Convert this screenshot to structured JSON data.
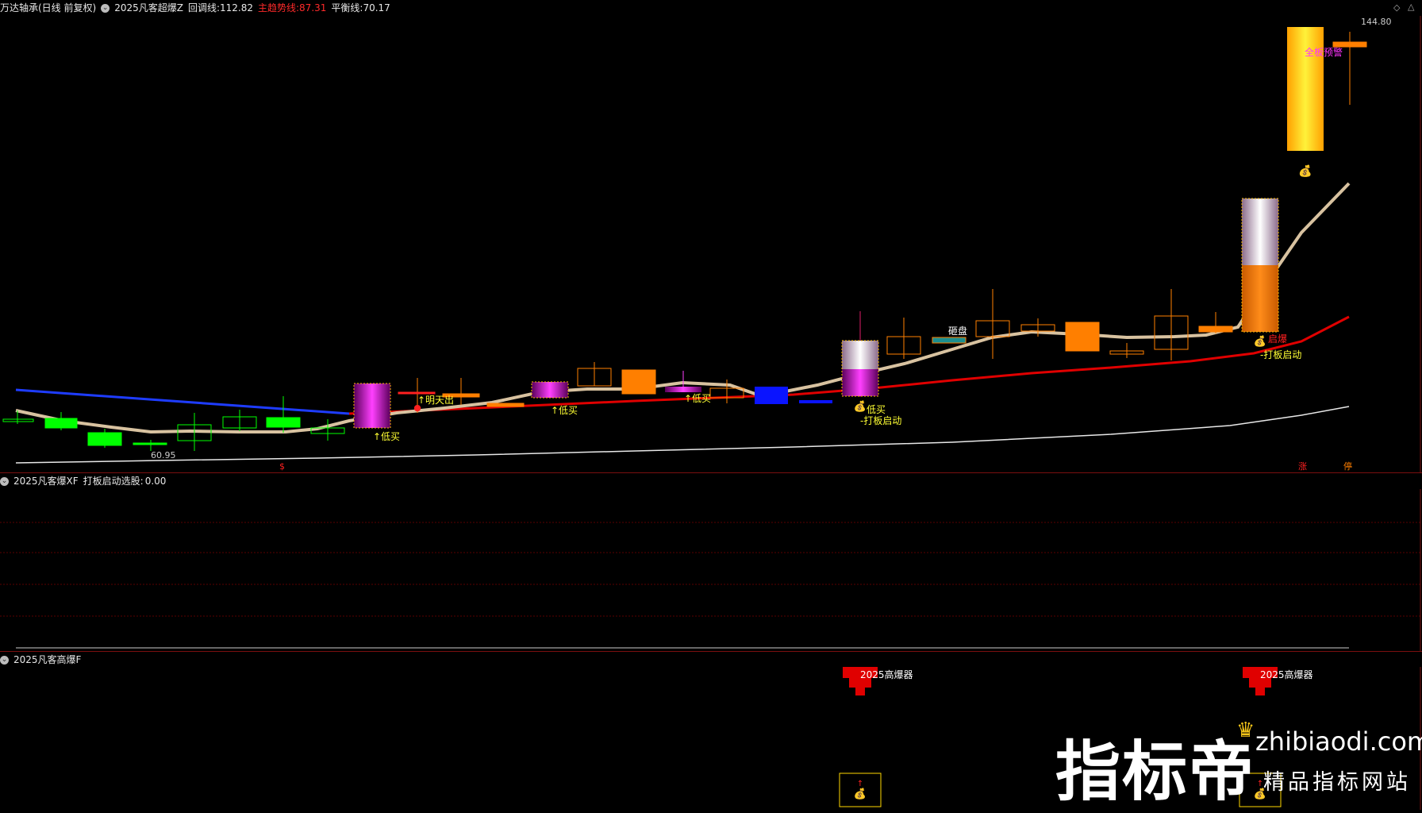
{
  "main_header": {
    "stock": "万达轴承(日线 前复权)",
    "indicator": "2025凡客超爆Z",
    "pullback_label": "回调线:",
    "pullback_value": "112.82",
    "trend_label": "主趋势线:",
    "trend_value": "87.31",
    "balance_label": "平衡线:",
    "balance_value": "70.17"
  },
  "price_labels": {
    "high": "144.80",
    "low": "60.95"
  },
  "annotations": {
    "low_buy_1": "↑低买",
    "low_buy_2": "↑低买",
    "low_buy_3": "↑低买",
    "tomorrow_out": "↑明天出",
    "low_buy_4": "低买",
    "board_start_1": "-打板启动",
    "smash": "砸盘",
    "start": "启爆",
    "board_start_2": "-打板启动",
    "full_board_warning": "全板预警",
    "rise": "涨",
    "stop": "停",
    "bottom_marker": "$"
  },
  "sub1_header": {
    "indicator": "2025凡客爆XF",
    "label": "打板启动选股:",
    "value": "0.00"
  },
  "sub2_header": {
    "indicator": "2025凡客高爆F"
  },
  "sub2_labels": {
    "signal_1": "2025高爆器",
    "signal_2": "2025高爆器"
  },
  "watermark": {
    "brand": "指标帝",
    "url": "zhibiaodi.com",
    "slogan": "精品指标网站"
  },
  "colors": {
    "up_candle": "#ff7f00",
    "down_candle": "#00ff00",
    "pullback_line": "#d8c2a0",
    "trend_line": "#e00000",
    "balance_line": "#e8e8e8",
    "falling_line": "#1e3cff",
    "label_yellow": "#ffff33",
    "warning_magenta": "#ff33ff",
    "signal_red": "#e00000"
  }
}
